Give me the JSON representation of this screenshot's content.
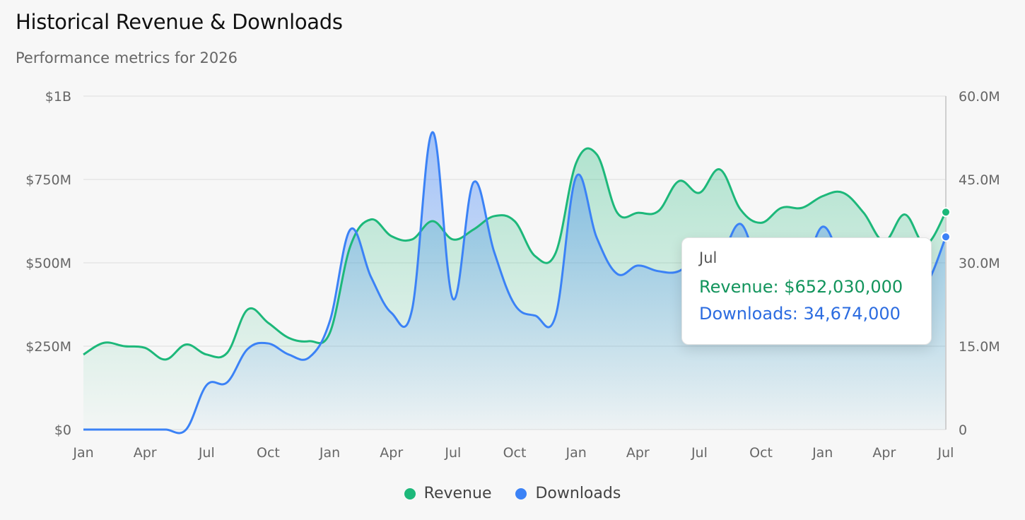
{
  "header": {
    "title": "Historical Revenue & Downloads",
    "subtitle": "Performance metrics for 2026"
  },
  "colors": {
    "revenue": "#1db87a",
    "downloads": "#3b82f6",
    "grid": "#e6e6e6"
  },
  "tooltip": {
    "month": "Jul",
    "revenue_text": "Revenue: $652,030,000",
    "downloads_text": "Downloads: 34,674,000"
  },
  "legend": {
    "revenue_label": "Revenue",
    "downloads_label": "Downloads"
  },
  "chart_data": {
    "type": "area",
    "title": "Historical Revenue & Downloads",
    "subtitle": "Performance metrics for 2026",
    "x_tick_labels": [
      "Jan",
      "Apr",
      "Jul",
      "Oct",
      "Jan",
      "Apr",
      "Jul",
      "Oct",
      "Jan",
      "Apr",
      "Jul",
      "Oct",
      "Jan",
      "Apr",
      "Jul"
    ],
    "y_left": {
      "ticks": [
        "$0",
        "$250M",
        "$500M",
        "$750M",
        "$1B"
      ],
      "range": [
        0,
        1000000000
      ]
    },
    "y_right": {
      "ticks": [
        "0",
        "15.0M",
        "30.0M",
        "45.0M",
        "60.0M"
      ],
      "range": [
        0,
        60000000
      ]
    },
    "grid": true,
    "legend_position": "bottom",
    "x": [
      "Jan",
      "Feb",
      "Mar",
      "Apr",
      "May",
      "Jun",
      "Jul",
      "Aug",
      "Sep",
      "Oct",
      "Nov",
      "Dec",
      "Jan",
      "Feb",
      "Mar",
      "Apr",
      "May",
      "Jun",
      "Jul",
      "Aug",
      "Sep",
      "Oct",
      "Nov",
      "Dec",
      "Jan",
      "Feb",
      "Mar",
      "Apr",
      "May",
      "Jun",
      "Jul",
      "Aug",
      "Sep",
      "Oct",
      "Nov",
      "Dec",
      "Jan",
      "Feb",
      "Mar",
      "Apr",
      "May",
      "Jun",
      "Jul"
    ],
    "series": [
      {
        "name": "Revenue",
        "axis": "left",
        "values": [
          225000000,
          260000000,
          250000000,
          245000000,
          210000000,
          255000000,
          225000000,
          230000000,
          360000000,
          320000000,
          275000000,
          265000000,
          290000000,
          550000000,
          630000000,
          580000000,
          570000000,
          625000000,
          570000000,
          600000000,
          640000000,
          625000000,
          520000000,
          530000000,
          800000000,
          825000000,
          650000000,
          650000000,
          655000000,
          745000000,
          710000000,
          780000000,
          660000000,
          620000000,
          665000000,
          665000000,
          700000000,
          710000000,
          650000000,
          565000000,
          645000000,
          555000000,
          652030000
        ]
      },
      {
        "name": "Downloads",
        "axis": "right",
        "values": [
          0,
          0,
          0,
          0,
          0,
          0,
          8000000,
          8500000,
          14500000,
          15500000,
          13500000,
          13000000,
          19500000,
          36000000,
          27500000,
          21000000,
          21500000,
          53500000,
          23500000,
          44500000,
          32000000,
          22500000,
          20500000,
          20500000,
          45500000,
          34500000,
          28000000,
          29500000,
          28500000,
          28500000,
          31500000,
          31000000,
          37000000,
          28500000,
          28500000,
          28000000,
          36500000,
          30000000,
          28000000,
          27500000,
          27000000,
          26000000,
          34674000
        ]
      }
    ]
  }
}
